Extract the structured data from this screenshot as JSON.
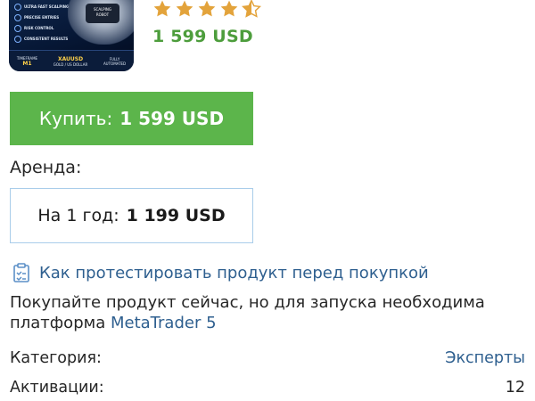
{
  "thumbnail": {
    "features": [
      "ULTRA FAST SCALPING",
      "PRECISE ENTRIES",
      "RISK CONTROL",
      "CONSISTENT RESULTS"
    ],
    "badge_line1": "SCALPING",
    "badge_line2": "ROBOT",
    "bar": [
      {
        "small": "TIMEFRAME",
        "big": "M1"
      },
      {
        "small": "",
        "big": "XAUUSD"
      },
      {
        "small": "FULLY",
        "big": "AUTOMATED"
      }
    ],
    "bar_sub": "GOLD / US DOLLAR"
  },
  "rating": {
    "value": 4.5,
    "max": 5,
    "color": "#e3a33b"
  },
  "price": "1 599 USD",
  "buy": {
    "label": "Купить:",
    "price": "1 599 USD",
    "color": "#5cb54b"
  },
  "rent": {
    "label": "Аренда:",
    "option_label": "На 1 год:",
    "option_price": "1 199 USD"
  },
  "test_link": "Как протестировать продукт перед покупкой",
  "info": {
    "text": "Покупайте продукт сейчас, но для запуска необходима платформа",
    "platform_link": "MetaTrader 5"
  },
  "details": {
    "category_label": "Категория:",
    "category_value": "Эксперты",
    "activations_label": "Активации:",
    "activations_value": "12"
  }
}
